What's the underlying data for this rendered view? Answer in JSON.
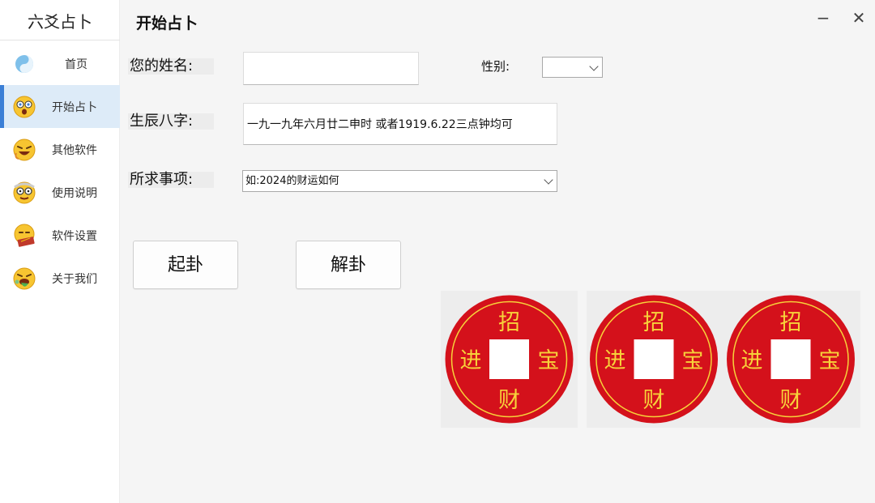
{
  "app": {
    "title": "六爻占卜"
  },
  "sidebar": {
    "items": [
      {
        "label": "首页",
        "icon": "yin-yang-icon",
        "active": false
      },
      {
        "label": "开始占卜",
        "icon": "surprised-emoji-icon",
        "active": true
      },
      {
        "label": "其他软件",
        "icon": "laughing-emoji-icon",
        "active": false
      },
      {
        "label": "使用说明",
        "icon": "nerd-emoji-icon",
        "active": false
      },
      {
        "label": "软件设置",
        "icon": "reading-emoji-icon",
        "active": false
      },
      {
        "label": "关于我们",
        "icon": "vomiting-emoji-icon",
        "active": false
      }
    ]
  },
  "header": {
    "title": "开始占卜",
    "minimize": "−",
    "close": "✕"
  },
  "form": {
    "name_label": "您的姓名:",
    "name_value": "",
    "gender_label": "性别:",
    "gender_value": "",
    "bazi_label": "生辰八字:",
    "bazi_value": "一九一九年六月廿二申时 或者1919.6.22三点钟均可",
    "matter_label": "所求事项:",
    "matter_value": "如:2024的财运如何"
  },
  "buttons": {
    "qigua": "起卦",
    "jiegua": "解卦"
  },
  "coins": [
    {
      "top": "招",
      "left": "进",
      "right": "宝",
      "bottom": "财"
    },
    {
      "top": "招",
      "left": "进",
      "right": "宝",
      "bottom": "财"
    },
    {
      "top": "招",
      "left": "进",
      "right": "宝",
      "bottom": "财"
    }
  ],
  "colors": {
    "accent": "#3b7fd6",
    "coin_red": "#d4111b",
    "coin_gold": "#f7d23a"
  }
}
